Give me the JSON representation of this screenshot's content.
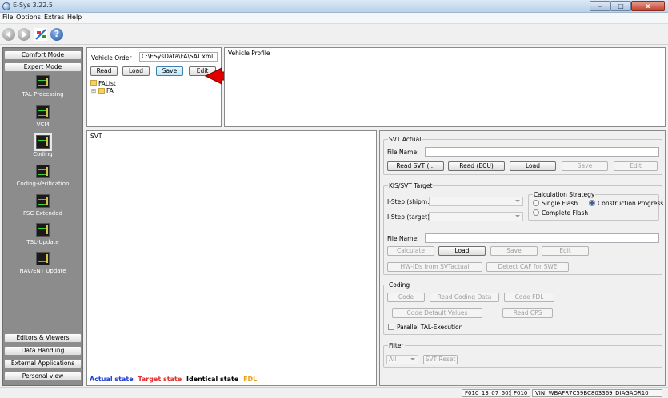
{
  "window": {
    "title": "E-Sys 3.22.5",
    "btn_min": "–",
    "btn_max": "□",
    "btn_close": "x"
  },
  "menu": [
    "File",
    "Options",
    "Extras",
    "Help"
  ],
  "toolbar": {
    "help_glyph": "?"
  },
  "left_panel": {
    "comfort_mode": "Comfort Mode",
    "expert_mode": "Expert Mode",
    "tools": [
      "TAL-Processing",
      "VCM",
      "Coding",
      "Coding-Verification",
      "FSC-Extended",
      "TSL-Update",
      "NAV/ENT Update"
    ],
    "bottom": [
      "Editors & Viewers",
      "Data Handling",
      "External Applications",
      "Personal view"
    ]
  },
  "vehicle_order": {
    "label": "Vehicle Order",
    "path": "C:\\ESysData\\FA\\SAT.xml",
    "btn_read": "Read",
    "btn_load": "Load",
    "btn_save": "Save",
    "btn_edit": "Edit",
    "tree_root": "FAList",
    "tree_child": "FA",
    "expand_glyph": "⊞"
  },
  "vehicle_profile": {
    "title": "Vehicle Profile"
  },
  "svt": {
    "title": "SVT",
    "legend": {
      "actual": "Actual state",
      "target": "Target state",
      "identical": "Identical state",
      "fdl": "FDL"
    },
    "colors": {
      "actual": "#1f3fd0",
      "target": "#e23030",
      "identical": "#000000",
      "fdl": "#e8a020"
    }
  },
  "svt_actual": {
    "title": "SVT Actual",
    "file_name_label": "File Name:",
    "btn_read_svt": "Read SVT (...",
    "btn_read_ecu": "Read (ECU)",
    "btn_load": "Load",
    "btn_save": "Save",
    "btn_edit": "Edit"
  },
  "kis_target": {
    "title": "KIS/SVT Target",
    "istep_shipm_label": "I-Step (shipm.):",
    "istep_target_label": "I-Step (target):",
    "calc_strategy": {
      "title": "Calculation Strategy",
      "single_flash": "Single Flash",
      "construction_progress": "Construction Progress",
      "complete_flash": "Complete Flash"
    },
    "file_name_label": "File Name:",
    "btn_calculate": "Calculate",
    "btn_load": "Load",
    "btn_save": "Save",
    "btn_edit": "Edit",
    "btn_hw_ids": "HW-IDs from SVTactual",
    "btn_detect_caf": "Detect CAF for SWE"
  },
  "coding": {
    "title": "Coding",
    "btn_code": "Code",
    "btn_read_coding_data": "Read Coding Data",
    "btn_code_fdl": "Code FDL",
    "btn_code_default": "Code Default Values",
    "btn_read_cps": "Read CPS",
    "parallel_tal": "Parallel TAL-Execution"
  },
  "filter": {
    "title": "Filter",
    "combo_value": "All",
    "btn_svt_reset": "SVT Reset"
  },
  "statusbar": {
    "cell1": "F010_13_07_505",
    "cell2": "F010",
    "cell3": "VIN: WBAFR7C59BC803369_DIAGADR10"
  }
}
